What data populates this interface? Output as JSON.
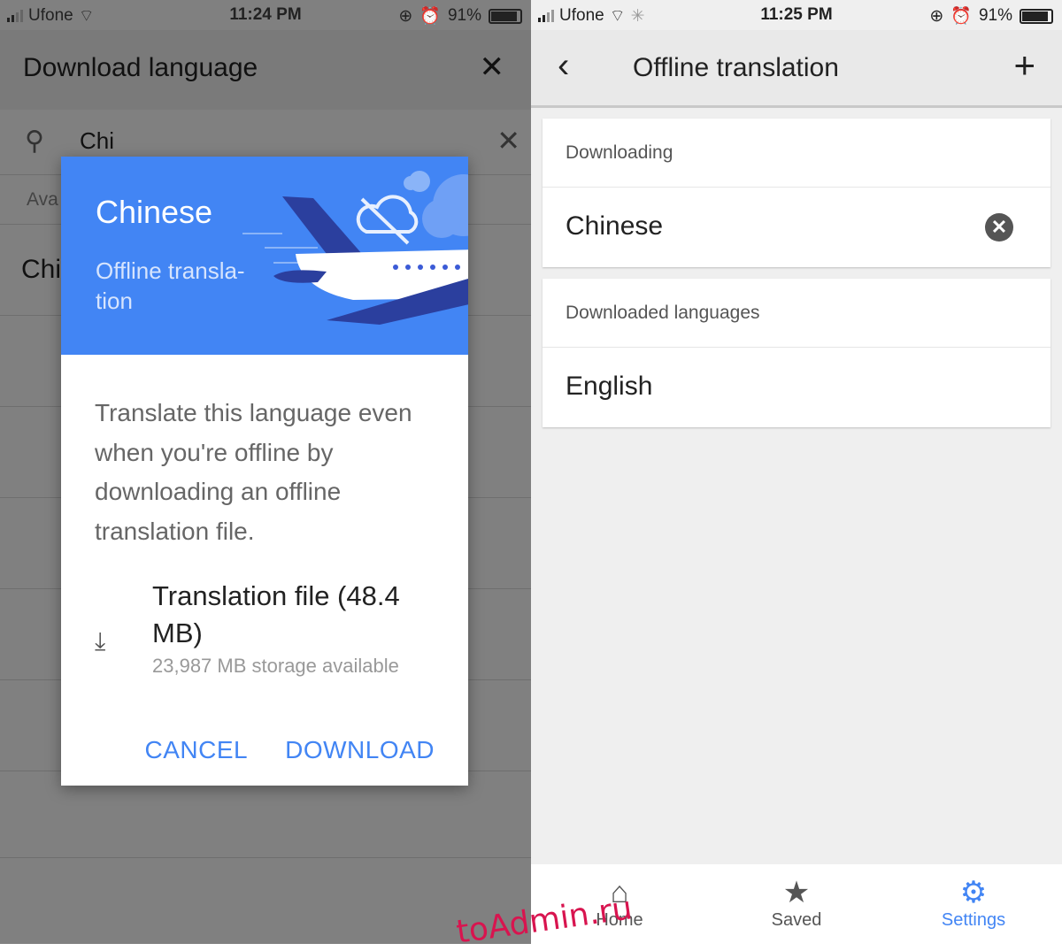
{
  "left": {
    "status": {
      "carrier": "Ufone",
      "time": "11:24 PM",
      "battery": "91%"
    },
    "header": {
      "title": "Download language",
      "close_icon": "close-icon"
    },
    "search": {
      "value": "Chi"
    },
    "section_label": "Ava",
    "result_row": "Chi",
    "dialog": {
      "title": "Chinese",
      "subtitle": "Offline transla-\ntion",
      "body": "Translate this language even when you're offline by downloading an offline translation file.",
      "file_name": "Translation file (48.4 MB)",
      "storage": "23,987 MB storage available",
      "cancel": "CANCEL",
      "download": "DOWNLOAD",
      "accent": "#4285f4"
    }
  },
  "right": {
    "status": {
      "carrier": "Ufone",
      "time": "11:25 PM",
      "battery": "91%"
    },
    "header": {
      "title": "Offline translation"
    },
    "downloading": {
      "label": "Downloading",
      "item": "Chinese"
    },
    "downloaded": {
      "label": "Downloaded languages",
      "item": "English"
    },
    "nav": [
      {
        "label": "Home",
        "icon": "home-icon"
      },
      {
        "label": "Saved",
        "icon": "star-icon"
      },
      {
        "label": "Settings",
        "icon": "gear-icon",
        "active": true
      }
    ]
  },
  "watermark": "toAdmin.ru"
}
